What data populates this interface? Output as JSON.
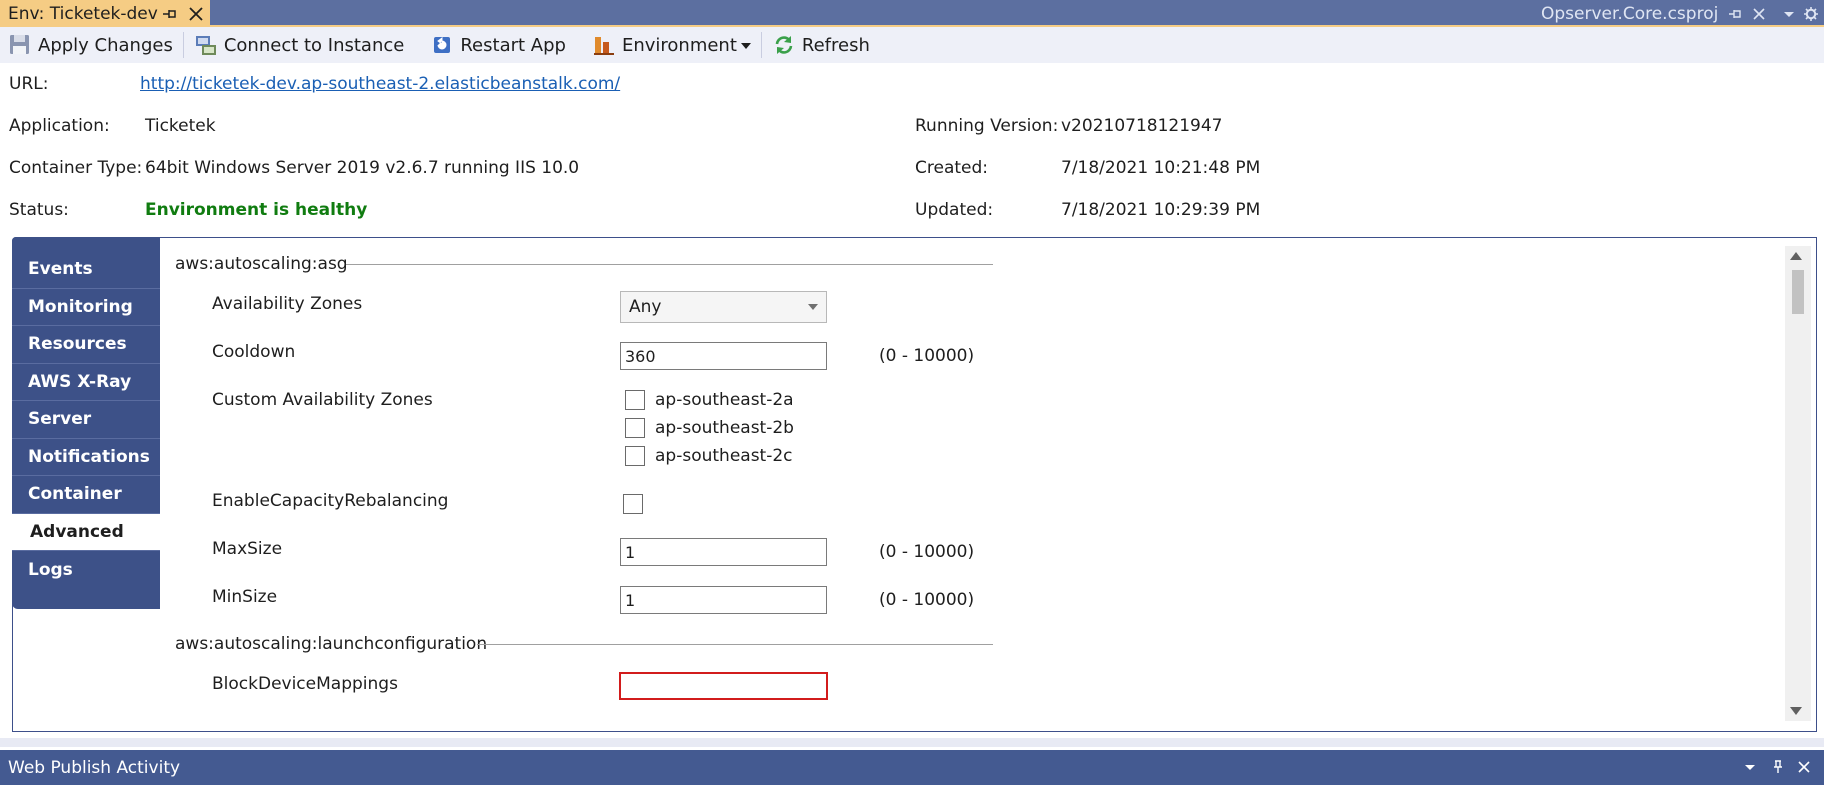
{
  "tabs": {
    "document_tab": "Env: Ticketek-dev",
    "right_tab": "Opserver.Core.csproj"
  },
  "toolbar": {
    "apply_changes": "Apply Changes",
    "connect_to_instance": "Connect to Instance",
    "restart_app": "Restart App",
    "environment": "Environment",
    "refresh": "Refresh"
  },
  "info": {
    "url_label": "URL:",
    "url_value": "http://ticketek-dev.ap-southeast-2.elasticbeanstalk.com/",
    "application_label": "Application:",
    "application_value": "Ticketek",
    "container_type_label": "Container Type:",
    "container_type_value": "64bit Windows Server 2019 v2.6.7 running IIS 10.0",
    "status_label": "Status:",
    "status_value": "Environment is healthy",
    "running_version_label": "Running Version:",
    "running_version_value": "v20210718121947",
    "created_label": "Created:",
    "created_value": "7/18/2021 10:21:48 PM",
    "updated_label": "Updated:",
    "updated_value": "7/18/2021 10:29:39 PM"
  },
  "sidebar": {
    "items": [
      {
        "label": "Events",
        "active": false
      },
      {
        "label": "Monitoring",
        "active": false
      },
      {
        "label": "Resources",
        "active": false
      },
      {
        "label": "AWS X-Ray",
        "active": false
      },
      {
        "label": "Server",
        "active": false
      },
      {
        "label": "Notifications",
        "active": false
      },
      {
        "label": "Container",
        "active": false
      },
      {
        "label": "Advanced",
        "active": true
      },
      {
        "label": "Logs",
        "active": false
      }
    ]
  },
  "advanced": {
    "section_asg": "aws:autoscaling:asg",
    "availability_zones_label": "Availability Zones",
    "availability_zones_value": "Any",
    "cooldown_label": "Cooldown",
    "cooldown_value": "360",
    "cooldown_range": "(0 - 10000)",
    "custom_zones_label": "Custom Availability Zones",
    "custom_zones": [
      "ap-southeast-2a",
      "ap-southeast-2b",
      "ap-southeast-2c"
    ],
    "capacity_rebalancing_label": "EnableCapacityRebalancing",
    "maxsize_label": "MaxSize",
    "maxsize_value": "1",
    "maxsize_range": "(0 - 10000)",
    "minsize_label": "MinSize",
    "minsize_value": "1",
    "minsize_range": "(0 - 10000)",
    "section_launch": "aws:autoscaling:launchconfiguration",
    "block_device_label": "BlockDeviceMappings",
    "block_device_value": ""
  },
  "bottom_panel": {
    "title": "Web Publish Activity"
  },
  "colors": {
    "accent_tab": "#f5cc84",
    "sidebar_bg": "#3d5188",
    "status_ok": "#107c10",
    "link": "#1a5fb4",
    "error_border": "#d21c1c"
  }
}
